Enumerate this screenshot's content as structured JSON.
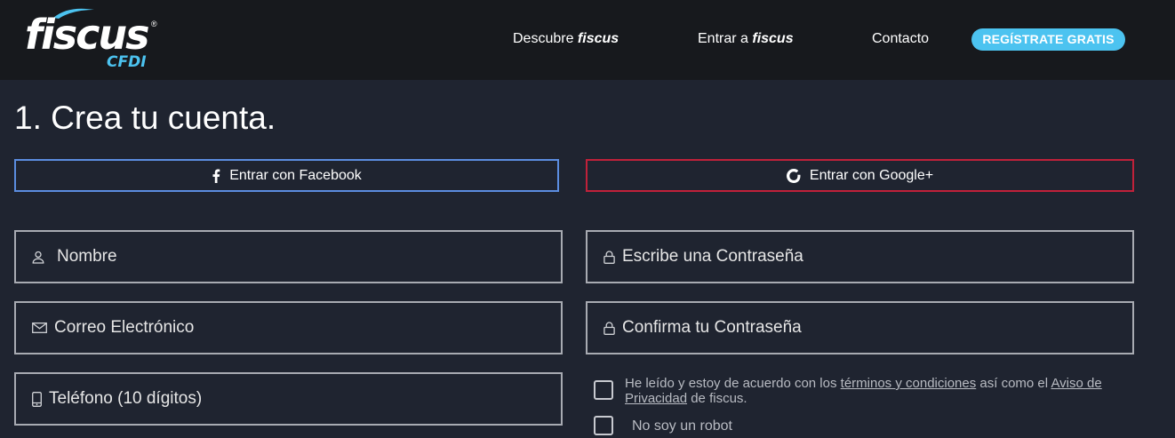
{
  "header": {
    "logo": {
      "wordmark": "fiscus",
      "registered": "®",
      "subtitle": "CFDI"
    },
    "nav": [
      {
        "prefix": "Descubre ",
        "brand": "fiscus"
      },
      {
        "prefix": "Entrar a ",
        "brand": "fiscus"
      },
      {
        "prefix": "Contacto",
        "brand": ""
      }
    ],
    "cta_label": "REGÍSTRATE GRATIS"
  },
  "page": {
    "title": "1. Crea tu cuenta."
  },
  "social": {
    "facebook_label": "Entrar con Facebook",
    "google_label": "Entrar con Google+"
  },
  "form": {
    "name_placeholder": "Nombre",
    "email_placeholder": "Correo Electrónico",
    "phone_placeholder": "Teléfono (10 dígitos)",
    "password_placeholder": "Escribe una Contraseña",
    "confirm_placeholder": "Confirma tu Contraseña",
    "terms": {
      "text_before": "He leído y estoy de acuerdo con los ",
      "terms_link": "términos y condiciones",
      "text_middle": " así como el ",
      "privacy_link": "Aviso de Privacidad",
      "text_after": " de fiscus."
    },
    "robot_label": "No soy un robot"
  },
  "colors": {
    "background": "#1f2430",
    "topbar": "#17191d",
    "accent": "#4cc3f0",
    "facebook_border": "#5b8de0",
    "google_border": "#c0213a",
    "field_border": "#a8abb2"
  },
  "icons": {
    "facebook": "facebook-icon",
    "google": "google-icon",
    "user": "user-icon",
    "mail": "mail-icon",
    "phone": "phone-icon",
    "lock": "lock-icon"
  }
}
